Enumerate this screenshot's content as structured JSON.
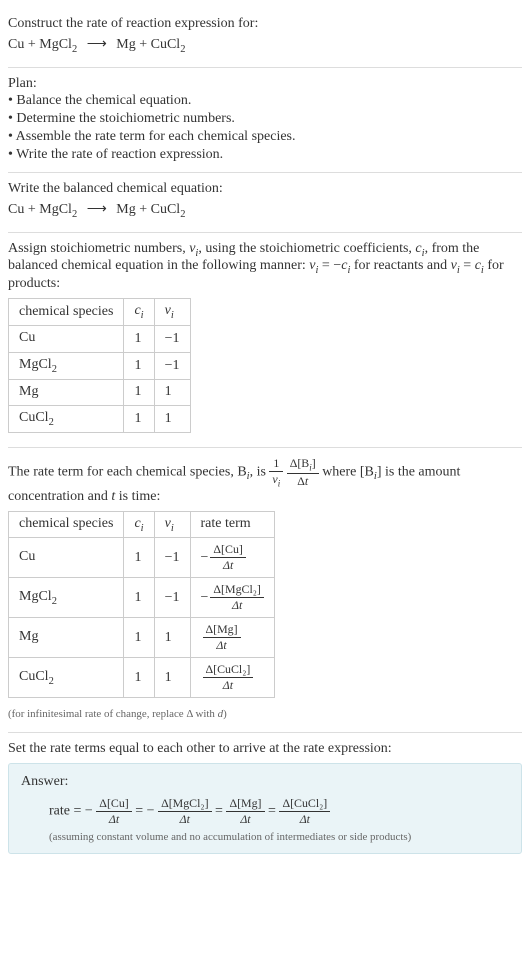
{
  "intro": {
    "prompt": "Construct the rate of reaction expression for:",
    "equation_lhs1": "Cu",
    "equation_lhs2": "MgCl",
    "equation_lhs2_sub": "2",
    "arrow": "⟶",
    "equation_rhs1": "Mg",
    "equation_rhs2": "CuCl",
    "equation_rhs2_sub": "2"
  },
  "plan": {
    "header": "Plan:",
    "items": [
      "• Balance the chemical equation.",
      "• Determine the stoichiometric numbers.",
      "• Assemble the rate term for each chemical species.",
      "• Write the rate of reaction expression."
    ]
  },
  "balanced": {
    "header": "Write the balanced chemical equation:"
  },
  "stoich": {
    "text1": "Assign stoichiometric numbers, ",
    "nu_i": "ν",
    "i": "i",
    "text2": ", using the stoichiometric coefficients, ",
    "c_i": "c",
    "text3": ", from the balanced chemical equation in the following manner: ",
    "eq1": " = −",
    "text4": " for reactants and ",
    "eq2": " = ",
    "text5": " for products:",
    "table": {
      "headers": [
        "chemical species",
        "cᵢ",
        "νᵢ"
      ],
      "rows": [
        {
          "species": "Cu",
          "sub": "",
          "c": "1",
          "nu": "−1"
        },
        {
          "species": "MgCl",
          "sub": "2",
          "c": "1",
          "nu": "−1"
        },
        {
          "species": "Mg",
          "sub": "",
          "c": "1",
          "nu": "1"
        },
        {
          "species": "CuCl",
          "sub": "2",
          "c": "1",
          "nu": "1"
        }
      ]
    }
  },
  "rateterm": {
    "text1": "The rate term for each chemical species, B",
    "text2": ", is ",
    "one": "1",
    "delta_b": "Δ[B",
    "delta_b2": "]",
    "delta_t": "Δt",
    "text3": " where [B",
    "text4": "] is the amount concentration and ",
    "t": "t",
    "text5": " is time:",
    "table": {
      "headers": [
        "chemical species",
        "cᵢ",
        "νᵢ",
        "rate term"
      ],
      "rows": [
        {
          "species": "Cu",
          "sub": "",
          "c": "1",
          "nu": "−1",
          "sign": "−",
          "dnum": "Δ[Cu]",
          "dden": "Δt"
        },
        {
          "species": "MgCl",
          "sub": "2",
          "c": "1",
          "nu": "−1",
          "sign": "−",
          "dnum": "Δ[MgCl₂]",
          "dden": "Δt"
        },
        {
          "species": "Mg",
          "sub": "",
          "c": "1",
          "nu": "1",
          "sign": "",
          "dnum": "Δ[Mg]",
          "dden": "Δt"
        },
        {
          "species": "CuCl",
          "sub": "2",
          "c": "1",
          "nu": "1",
          "sign": "",
          "dnum": "Δ[CuCl₂]",
          "dden": "Δt"
        }
      ]
    },
    "note": "(for infinitesimal rate of change, replace Δ with d)"
  },
  "final": {
    "header": "Set the rate terms equal to each other to arrive at the rate expression:"
  },
  "answer": {
    "label": "Answer:",
    "rate": "rate",
    "eq": " = ",
    "neg": "−",
    "terms": [
      {
        "num": "Δ[Cu]",
        "den": "Δt"
      },
      {
        "num": "Δ[MgCl₂]",
        "den": "Δt"
      },
      {
        "num": "Δ[Mg]",
        "den": "Δt"
      },
      {
        "num": "Δ[CuCl₂]",
        "den": "Δt"
      }
    ],
    "note": "(assuming constant volume and no accumulation of intermediates or side products)"
  }
}
